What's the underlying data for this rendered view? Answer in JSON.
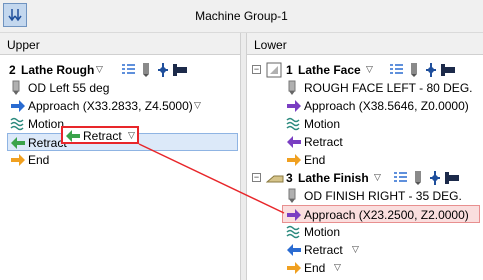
{
  "window": {
    "title": "Machine Group-1"
  },
  "panes": {
    "upper": {
      "header": "Upper",
      "operation": {
        "number": "2",
        "name": "Lathe Rough"
      },
      "items": [
        {
          "label": "OD Left 55 deg"
        },
        {
          "label": "Approach (X33.2833, Z4.5000)"
        },
        {
          "label": "Motion"
        },
        {
          "label": "Retract"
        },
        {
          "label": "End"
        }
      ],
      "drag_label": "Retract"
    },
    "lower": {
      "header": "Lower",
      "op1": {
        "number": "1",
        "name": "Lathe Face",
        "items": [
          {
            "label": "ROUGH FACE LEFT - 80 DEG."
          },
          {
            "label": "Approach (X38.5646, Z0.0000)"
          },
          {
            "label": "Motion"
          },
          {
            "label": "Retract"
          },
          {
            "label": "End"
          }
        ]
      },
      "op3": {
        "number": "3",
        "name": "Lathe Finish",
        "items": [
          {
            "label": "OD FINISH RIGHT - 35 DEG."
          },
          {
            "label": "Approach (X23.2500, Z2.0000)"
          },
          {
            "label": "Motion"
          },
          {
            "label": "Retract"
          },
          {
            "label": "End"
          }
        ]
      }
    }
  },
  "glyphs": {
    "dropdown": "▽",
    "collapse": "−"
  },
  "colors": {
    "accent": "#2a6bd1",
    "drag_indicator": "#e8262a",
    "selection": "#dce9f9",
    "drop_target": "#fadede"
  }
}
